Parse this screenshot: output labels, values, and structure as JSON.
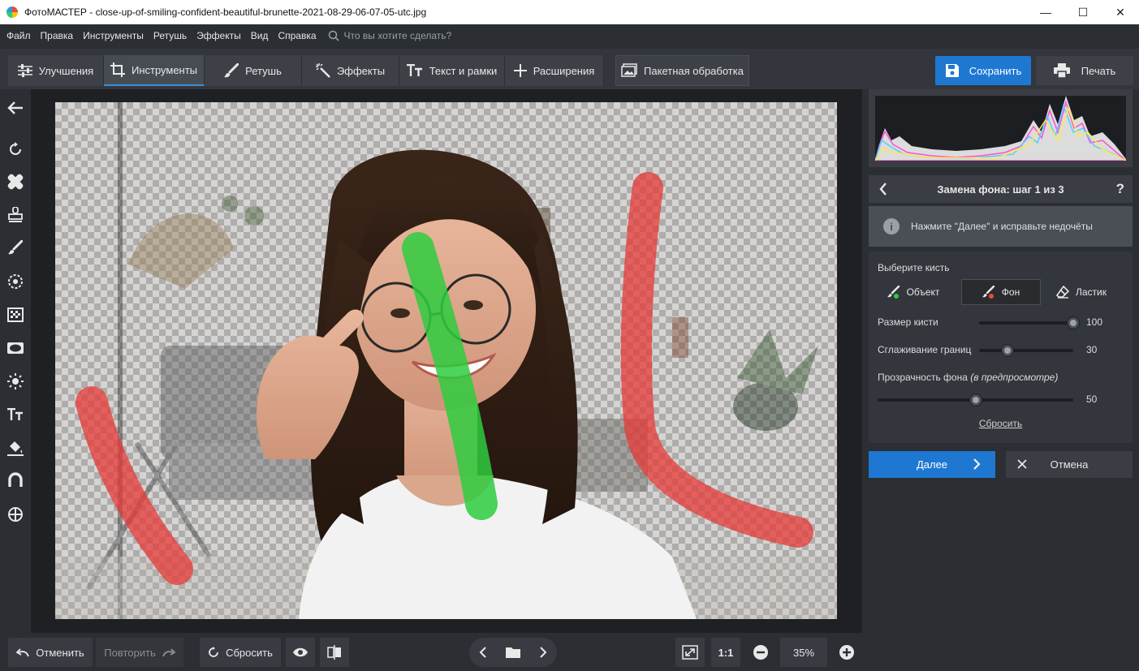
{
  "window": {
    "title": "ФотоМАСТЕР - close-up-of-smiling-confident-beautiful-brunette-2021-08-29-06-07-05-utc.jpg",
    "minimize": "—",
    "maximize": "☐",
    "close": "✕"
  },
  "menu": {
    "items": [
      "Файл",
      "Правка",
      "Инструменты",
      "Ретушь",
      "Эффекты",
      "Вид",
      "Справка"
    ],
    "search_placeholder": "Что вы хотите сделать?"
  },
  "toolbar": {
    "tabs": [
      {
        "label": "Улучшения",
        "icon": "sliders-icon"
      },
      {
        "label": "Инструменты",
        "icon": "crop-icon",
        "active": true
      },
      {
        "label": "Ретушь",
        "icon": "brush-icon"
      },
      {
        "label": "Эффекты",
        "icon": "magic-wand-icon"
      },
      {
        "label": "Текст и рамки",
        "icon": "text-icon"
      },
      {
        "label": "Расширения",
        "icon": "plus-icon"
      }
    ],
    "batch_label": "Пакетная обработка",
    "save_label": "Сохранить",
    "print_label": "Печать",
    "accent_color": "#1e78d2"
  },
  "left_tools": [
    "back-arrow-icon",
    "rotate-icon",
    "bandage-icon",
    "stamp-icon",
    "brush-icon",
    "target-icon",
    "grid-icon",
    "vignette-icon",
    "sun-icon",
    "text-icon",
    "fill-bucket-icon",
    "magnet-lasso-icon",
    "crosshair-icon"
  ],
  "bottom": {
    "undo_label": "Отменить",
    "redo_label": "Повторить",
    "reset_label": "Сбросить",
    "ratio_label": "1:1",
    "zoom_value": "35%"
  },
  "panel": {
    "step_title": "Замена фона: шаг 1 из 3",
    "help": "?",
    "hint": "Нажмите \"Далее\" и исправьте недочёты",
    "info_glyph": "i",
    "brush_section_label": "Выберите кисть",
    "brushes": [
      {
        "label": "Объект",
        "dot_color": "#2ecc40"
      },
      {
        "label": "Фон",
        "dot_color": "#e74c3c",
        "active": true
      },
      {
        "label": "Ластик"
      }
    ],
    "brush_size_label": "Размер кисти",
    "brush_size_value": "100",
    "brush_size_fraction": 1.0,
    "smooth_label": "Сглаживание границ",
    "smooth_value": "30",
    "smooth_fraction": 0.3,
    "opacity_label": "Прозрачность фона",
    "opacity_note": "(в предпросмотре)",
    "opacity_value": "50",
    "opacity_fraction": 0.5,
    "reset_label": "Сбросить",
    "next_label": "Далее",
    "cancel_label": "Отмена"
  },
  "strokes": {
    "object_color": "#2ecc40",
    "background_color": "#e53935"
  }
}
